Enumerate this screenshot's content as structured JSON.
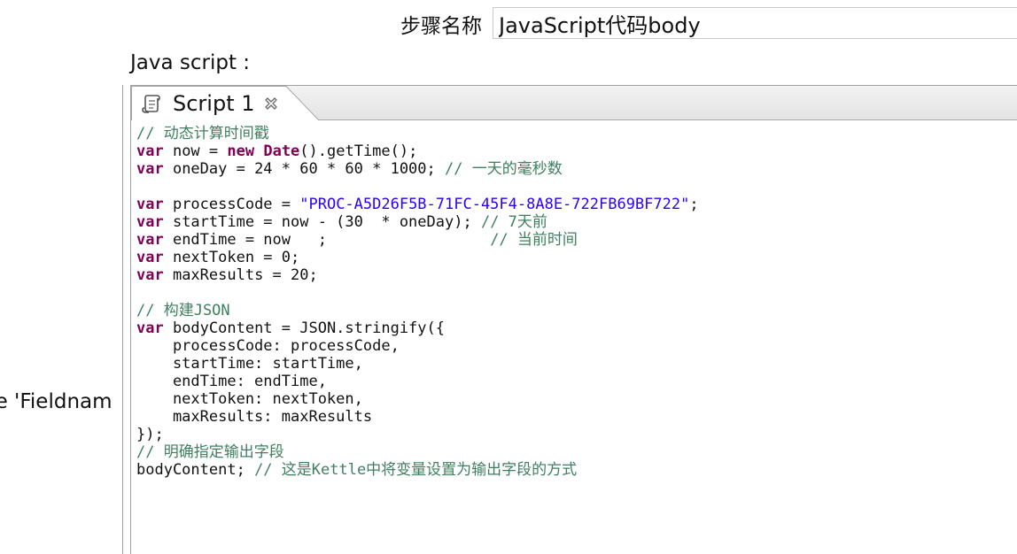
{
  "step": {
    "label": "步骤名称",
    "value": "JavaScript代码body"
  },
  "section_label": "Java script :",
  "left_panel": {
    "partial_text": "ue 'Fieldnam"
  },
  "editor": {
    "tab": {
      "title": "Script 1",
      "icon": "script-scroll-icon",
      "close_icon": "close-x-icon"
    },
    "lines": [
      [
        {
          "t": "// 动态计算时间戳",
          "c": "cm"
        }
      ],
      [
        {
          "t": "var",
          "c": "kw"
        },
        {
          "t": " now = ",
          "c": ""
        },
        {
          "t": "new",
          "c": "kw"
        },
        {
          "t": " ",
          "c": ""
        },
        {
          "t": "Date",
          "c": "kw"
        },
        {
          "t": "().getTime();",
          "c": ""
        }
      ],
      [
        {
          "t": "var",
          "c": "kw"
        },
        {
          "t": " oneDay = 24 * 60 * 60 * 1000; ",
          "c": ""
        },
        {
          "t": "// 一天的毫秒数",
          "c": "cm"
        }
      ],
      [],
      [
        {
          "t": "var",
          "c": "kw"
        },
        {
          "t": " processCode = ",
          "c": ""
        },
        {
          "t": "\"PROC-A5D26F5B-71FC-45F4-8A8E-722FB69BF722\"",
          "c": "str"
        },
        {
          "t": ";",
          "c": ""
        }
      ],
      [
        {
          "t": "var",
          "c": "kw"
        },
        {
          "t": " startTime = now - (30  * oneDay); ",
          "c": ""
        },
        {
          "t": "// 7天前",
          "c": "cm"
        }
      ],
      [
        {
          "t": "var",
          "c": "kw"
        },
        {
          "t": " endTime = now   ;                  ",
          "c": ""
        },
        {
          "t": "// 当前时间",
          "c": "cm"
        }
      ],
      [
        {
          "t": "var",
          "c": "kw"
        },
        {
          "t": " nextToken = 0;",
          "c": ""
        }
      ],
      [
        {
          "t": "var",
          "c": "kw"
        },
        {
          "t": " maxResults = 20;",
          "c": ""
        }
      ],
      [],
      [
        {
          "t": "// 构建JSON",
          "c": "cm"
        }
      ],
      [
        {
          "t": "var",
          "c": "kw"
        },
        {
          "t": " bodyContent = JSON.stringify({",
          "c": ""
        }
      ],
      [
        {
          "t": "    processCode: processCode,",
          "c": ""
        }
      ],
      [
        {
          "t": "    startTime: startTime,",
          "c": ""
        }
      ],
      [
        {
          "t": "    endTime: endTime,",
          "c": ""
        }
      ],
      [
        {
          "t": "    nextToken: nextToken,",
          "c": ""
        }
      ],
      [
        {
          "t": "    maxResults: maxResults",
          "c": ""
        }
      ],
      [
        {
          "t": "});",
          "c": ""
        }
      ],
      [
        {
          "t": "// 明确指定输出字段",
          "c": "cm"
        }
      ],
      [
        {
          "t": "bodyContent; ",
          "c": ""
        },
        {
          "t": "// 这是Kettle中将变量设置为输出字段的方式",
          "c": "cm"
        }
      ]
    ]
  }
}
